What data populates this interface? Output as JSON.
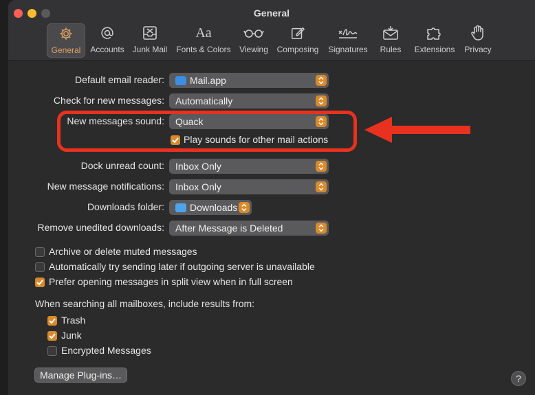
{
  "window": {
    "title": "General"
  },
  "toolbar": {
    "tabs": [
      {
        "label": "General"
      },
      {
        "label": "Accounts"
      },
      {
        "label": "Junk Mail"
      },
      {
        "label": "Fonts & Colors"
      },
      {
        "label": "Viewing"
      },
      {
        "label": "Composing"
      },
      {
        "label": "Signatures"
      },
      {
        "label": "Rules"
      },
      {
        "label": "Extensions"
      },
      {
        "label": "Privacy"
      }
    ],
    "active_tab": "General",
    "fonts_icon_text": "Aa"
  },
  "settings": {
    "default_reader": {
      "label": "Default email reader:",
      "value": "Mail.app"
    },
    "check_new": {
      "label": "Check for new messages:",
      "value": "Automatically"
    },
    "new_sound": {
      "label": "New messages sound:",
      "value": "Quack"
    },
    "play_sounds": {
      "label": "Play sounds for other mail actions",
      "checked": true
    },
    "dock_unread": {
      "label": "Dock unread count:",
      "value": "Inbox Only"
    },
    "notifications": {
      "label": "New message notifications:",
      "value": "Inbox Only"
    },
    "downloads_folder": {
      "label": "Downloads folder:",
      "value": "Downloads"
    },
    "remove_downloads": {
      "label": "Remove unedited downloads:",
      "value": "After Message is Deleted"
    }
  },
  "options": {
    "archive_muted": {
      "label": "Archive or delete muted messages",
      "checked": false
    },
    "try_later": {
      "label": "Automatically try sending later if outgoing server is unavailable",
      "checked": false
    },
    "split_view": {
      "label": "Prefer opening messages in split view when in full screen",
      "checked": true
    }
  },
  "search": {
    "heading": "When searching all mailboxes, include results from:",
    "trash": {
      "label": "Trash",
      "checked": true
    },
    "junk": {
      "label": "Junk",
      "checked": true
    },
    "encrypted": {
      "label": "Encrypted Messages",
      "checked": false
    }
  },
  "buttons": {
    "manage_plugins": "Manage Plug-ins…",
    "help": "?"
  },
  "colors": {
    "accent": "#d88a2c",
    "annotation": "#e8321f"
  }
}
